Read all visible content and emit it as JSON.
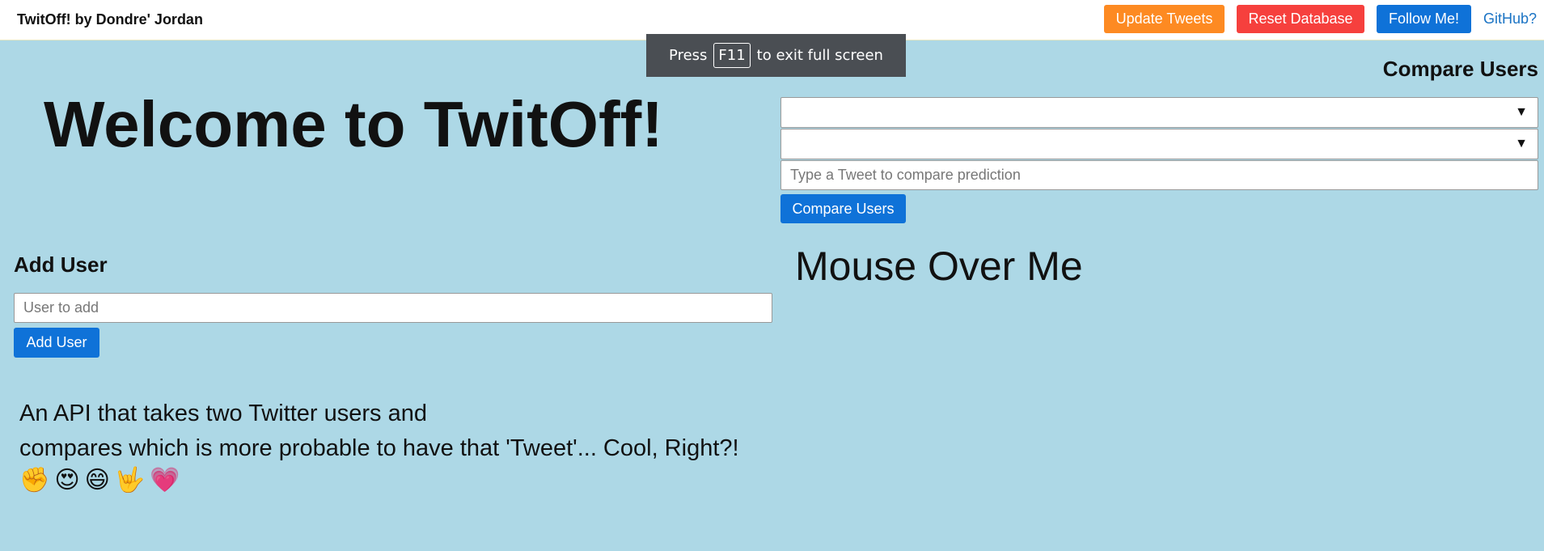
{
  "navbar": {
    "brand": "TwitOff! by Dondre' Jordan",
    "update_label": "Update Tweets",
    "reset_label": "Reset Database",
    "follow_label": "Follow Me!",
    "github_label": "GitHub?"
  },
  "fullscreen_notice": {
    "prefix": "Press",
    "key": "F11",
    "suffix": "to exit full screen"
  },
  "main": {
    "welcome": "Welcome to TwitOff!",
    "mouse_over": "Mouse Over Me"
  },
  "compare": {
    "title": "Compare Users",
    "user1_value": "",
    "user2_value": "",
    "tweet_placeholder": "Type a Tweet to compare prediction",
    "button_label": "Compare Users"
  },
  "add_user": {
    "title": "Add User",
    "input_placeholder": "User to add",
    "button_label": "Add User"
  },
  "description": {
    "line1": "An API that takes two Twitter users and",
    "line2": "compares which is more probable to have that 'Tweet'... Cool, Right?!",
    "emojis": "✊😍😄🤟💗"
  },
  "colors": {
    "background": "#add8e6",
    "update_button": "#fd8a22",
    "reset_button": "#f6403d",
    "primary_button": "#0f72d8"
  },
  "icons": {
    "select_arrow": "dropdown-arrow-icon"
  }
}
